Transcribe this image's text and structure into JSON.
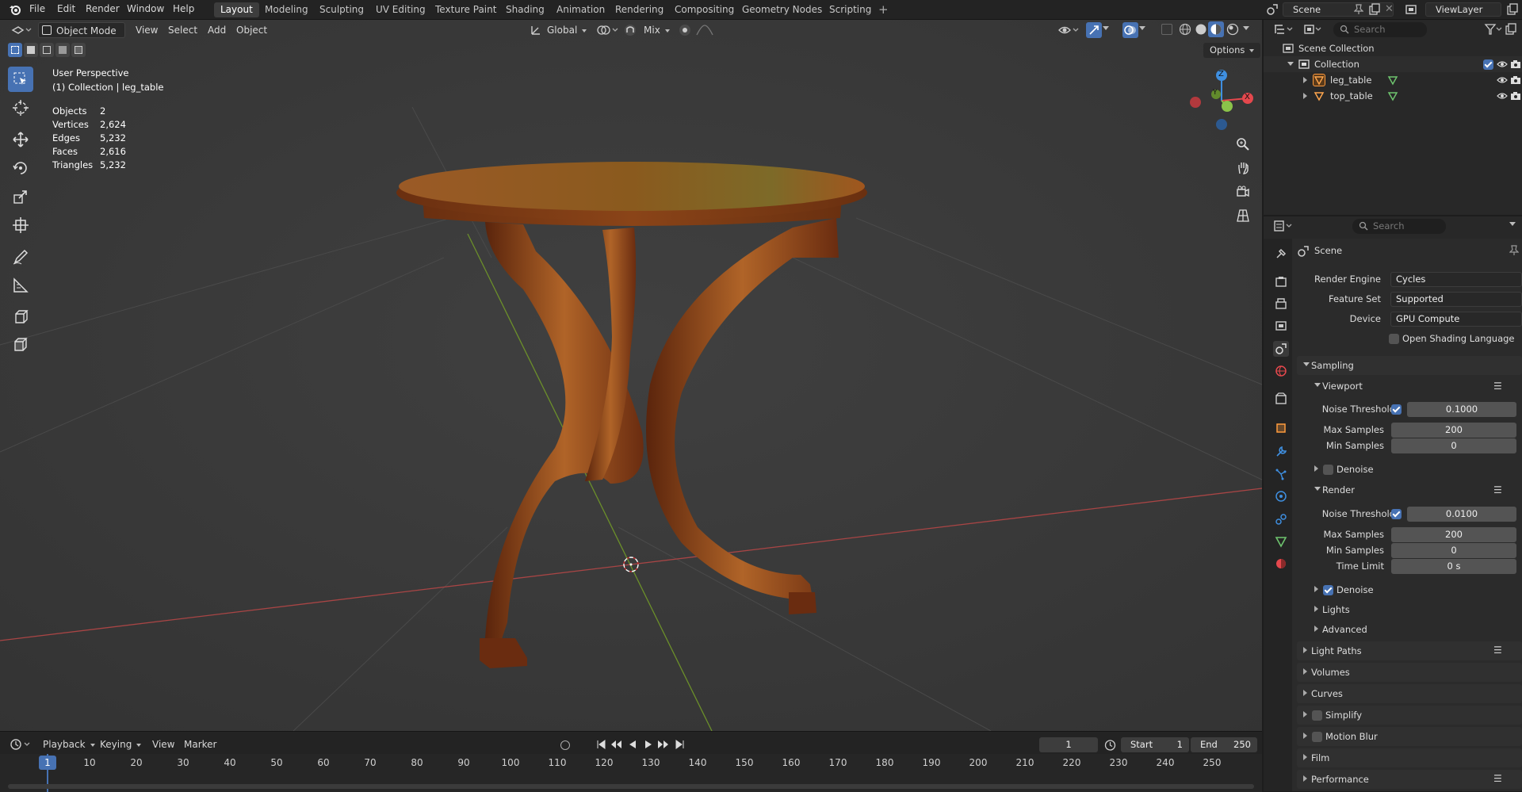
{
  "menu": {
    "file": "File",
    "edit": "Edit",
    "render": "Render",
    "window": "Window",
    "help": "Help"
  },
  "workspaces": [
    "Layout",
    "Modeling",
    "Sculpting",
    "UV Editing",
    "Texture Paint",
    "Shading",
    "Animation",
    "Rendering",
    "Compositing",
    "Geometry Nodes",
    "Scripting"
  ],
  "active_workspace": "Layout",
  "scene_name": "Scene",
  "view_layer": "ViewLayer",
  "viewport_header": {
    "mode": "Object Mode",
    "view": "View",
    "select": "Select",
    "add": "Add",
    "object": "Object",
    "orientation": "Global",
    "snap_mode": "Mix",
    "options": "Options"
  },
  "overlay_text": {
    "perspective": "User Perspective",
    "collection": "(1) Collection | leg_table"
  },
  "stats": [
    {
      "label": "Objects",
      "value": "2"
    },
    {
      "label": "Vertices",
      "value": "2,624"
    },
    {
      "label": "Edges",
      "value": "5,232"
    },
    {
      "label": "Faces",
      "value": "2,616"
    },
    {
      "label": "Triangles",
      "value": "5,232"
    }
  ],
  "gizmo": {
    "z": "Z",
    "x": "X",
    "y": "Y"
  },
  "outliner": {
    "search_placeholder": "Search",
    "scene_collection": "Scene Collection",
    "collection": "Collection",
    "objects": [
      "leg_table",
      "top_table"
    ]
  },
  "properties": {
    "search_placeholder": "Search",
    "context": "Scene",
    "render_engine_label": "Render Engine",
    "render_engine": "Cycles",
    "feature_set_label": "Feature Set",
    "feature_set": "Supported",
    "device_label": "Device",
    "device": "GPU Compute",
    "osl_label": "Open Shading Language",
    "sampling": "Sampling",
    "viewport": "Viewport",
    "vp_noise_label": "Noise Threshold",
    "vp_noise": "0.1000",
    "vp_max_label": "Max Samples",
    "vp_max": "200",
    "vp_min_label": "Min Samples",
    "vp_min": "0",
    "vp_denoise": "Denoise",
    "render": "Render",
    "r_noise_label": "Noise Threshold",
    "r_noise": "0.0100",
    "r_max_label": "Max Samples",
    "r_max": "200",
    "r_min_label": "Min Samples",
    "r_min": "0",
    "r_time_label": "Time Limit",
    "r_time": "0 s",
    "r_denoise": "Denoise",
    "lights": "Lights",
    "advanced": "Advanced",
    "light_paths": "Light Paths",
    "volumes": "Volumes",
    "curves": "Curves",
    "simplify": "Simplify",
    "motion_blur": "Motion Blur",
    "film": "Film",
    "performance": "Performance"
  },
  "timeline": {
    "playback": "Playback",
    "keying": "Keying",
    "view": "View",
    "marker": "Marker",
    "current_frame": "1",
    "start_label": "Start",
    "start": "1",
    "end_label": "End",
    "end": "250",
    "ruler": [
      "10",
      "20",
      "30",
      "40",
      "50",
      "60",
      "70",
      "80",
      "90",
      "100",
      "110",
      "120",
      "130",
      "140",
      "150",
      "160",
      "170",
      "180",
      "190",
      "200",
      "210",
      "220",
      "230",
      "240",
      "250"
    ],
    "current_marker": "1"
  },
  "colors": {
    "accent": "#4772b3",
    "x_axis": "#e5484d",
    "y_axis": "#8bc34a",
    "z_axis": "#3f8fe0",
    "wood": "#8a4a1c"
  }
}
